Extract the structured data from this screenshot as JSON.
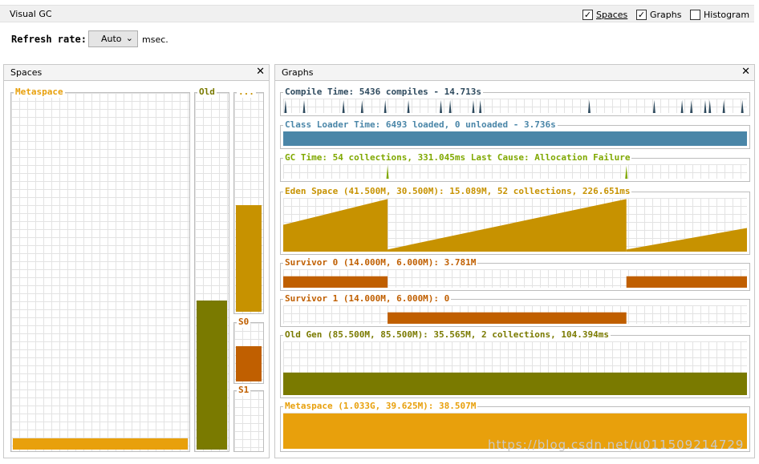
{
  "app": {
    "title": "Visual GC"
  },
  "options": [
    {
      "label": "Spaces",
      "checked": true
    },
    {
      "label": "Graphs",
      "checked": true
    },
    {
      "label": "Histogram",
      "checked": false
    }
  ],
  "refresh": {
    "label": "Refresh rate:",
    "value": "Auto",
    "unit": "msec."
  },
  "spaces_panel": {
    "title": "Spaces",
    "metaspace": {
      "label": "Metaspace",
      "fill": 0.032,
      "color": "#e8a00c"
    },
    "old": {
      "label": "Old",
      "fill": 0.42,
      "color": "#7a7a00"
    },
    "eden": {
      "label": "...",
      "fill": 0.49,
      "color": "#c79200"
    },
    "s0": {
      "label": "S0",
      "fill": 0.62,
      "color": "#c05f00"
    },
    "s1": {
      "label": "S1",
      "fill": 0.0,
      "color": "#c05f00"
    }
  },
  "graphs_panel": {
    "title": "Graphs",
    "compile": {
      "label": "Compile Time: 5436 compiles - 14.713s",
      "color": "#2e4a5e",
      "spikes": [
        0.5,
        4.5,
        13,
        17,
        22,
        27,
        34,
        36,
        41,
        42.5,
        66,
        80,
        86,
        88,
        91,
        92,
        95,
        99
      ]
    },
    "classloader": {
      "label": "Class Loader Time: 6493 loaded, 0 unloaded - 3.736s",
      "color": "#4a86a8",
      "fill": 1.0
    },
    "gc": {
      "label": "GC Time: 54 collections, 331.045ms Last Cause: Allocation Failure",
      "color": "#7fa800",
      "spikes": [
        22.5,
        74
      ]
    },
    "eden": {
      "label": "Eden Space (41.500M, 30.500M): 15.089M, 52 collections, 226.651ms",
      "color": "#c79200",
      "segments": [
        {
          "from": 0,
          "to": 22.5,
          "y0": 0.5,
          "y1": 0.98
        },
        {
          "from": 22.5,
          "to": 74,
          "y0": 0.04,
          "y1": 0.98
        },
        {
          "from": 74,
          "to": 100,
          "y0": 0.04,
          "y1": 0.44
        }
      ]
    },
    "survivor0": {
      "label": "Survivor 0 (14.000M, 6.000M): 3.781M",
      "color": "#c05f00",
      "ranges": [
        [
          0,
          22.5
        ],
        [
          74,
          100
        ]
      ],
      "fill": 0.62
    },
    "survivor1": {
      "label": "Survivor 1 (14.000M, 6.000M): 0",
      "color": "#c05f00",
      "ranges": [
        [
          22.5,
          74
        ]
      ],
      "fill": 0.62
    },
    "oldgen": {
      "label": "Old Gen (85.500M, 85.500M): 35.565M, 2 collections, 104.394ms",
      "color": "#7a7a00",
      "fill": 0.42
    },
    "metaspace": {
      "label": "Metaspace (1.033G, 39.625M): 38.507M",
      "color": "#e8a00c",
      "fill": 0.98
    }
  },
  "watermark": "https://blog.csdn.net/u011509214729"
}
